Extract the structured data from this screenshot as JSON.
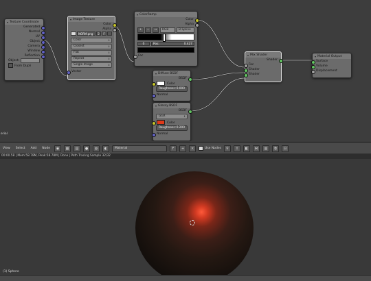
{
  "node_editor": {
    "editor_label": "erial",
    "texture_coordinate": {
      "title": "Texture Coordinate",
      "outputs": [
        "Generated",
        "Normal",
        "UV",
        "Object",
        "Camera",
        "Window",
        "Reflection"
      ],
      "object_label": "Object:",
      "from_dupli_label": "From Dupli"
    },
    "image_texture": {
      "title": "Image Texture",
      "outputs": [
        "Color",
        "Alpha"
      ],
      "image_name": "NORM.png",
      "image_users": "2",
      "image_f": "F",
      "color_space": "Color",
      "interpolation": "Closest",
      "projection": "Flat",
      "extension": "Repeat",
      "source": "Single Image",
      "input_vector": "Vector"
    },
    "colorramp": {
      "title": "ColorRamp",
      "outputs": [
        "Color",
        "Alpha"
      ],
      "add_btn": "+",
      "remove_btn": "−",
      "flip_btn": "↔",
      "color_mode": "RGB",
      "interp": "B-Spline",
      "index": "0",
      "pos_label": "Pos:",
      "pos_value": "0.427",
      "input_fac": "Fac"
    },
    "mix_shader": {
      "title": "Mix Shader",
      "output": "Shader",
      "inputs": [
        "Fac",
        "Shader",
        "Shader"
      ]
    },
    "material_output": {
      "title": "Material Output",
      "inputs": [
        "Surface",
        "Volume",
        "Displacement"
      ]
    },
    "diffuse_bsdf": {
      "title": "Diffuse BSDF",
      "output": "BSDF",
      "color_label": "Color",
      "roughness_label": "Roughness:",
      "roughness_value": "0.000",
      "normal_label": "Normal",
      "color_hex": "#ffffff"
    },
    "glossy_bsdf": {
      "title": "Glossy BSDF",
      "output": "BSDF",
      "distribution": "GGX",
      "color_label": "Color",
      "roughness_label": "Roughness:",
      "roughness_value": "0.200",
      "normal_label": "Normal",
      "color_hex": "#e03a1a"
    }
  },
  "header": {
    "menus": [
      "View",
      "Select",
      "Add",
      "Node"
    ],
    "material_name": "Material",
    "use_nodes_label": "Use Nodes"
  },
  "status": {
    "text": "00:00.58 | Mem:58.78M, Peak:58.78M | Done | Path Tracing Sample 32/32"
  },
  "viewport": {
    "object_label": "(1) Sphere"
  }
}
